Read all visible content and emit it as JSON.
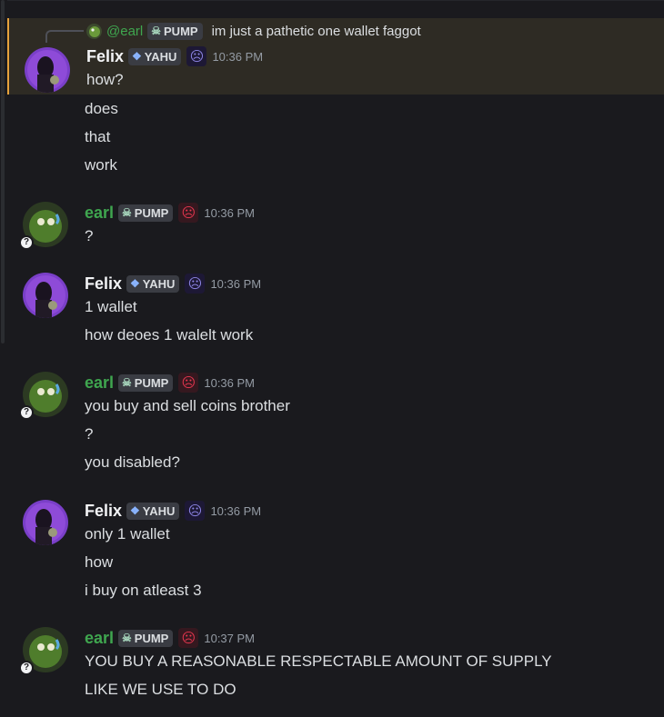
{
  "reply": {
    "mention": "@earl",
    "tag": "PUMP",
    "text": "im just a pathetic one wallet faggot"
  },
  "messages": [
    {
      "author": "Felix",
      "tag": "YAHU",
      "time": "10:36 PM",
      "lines": [
        "how?",
        "does",
        "that",
        "work"
      ]
    },
    {
      "author": "earl",
      "tag": "PUMP",
      "time": "10:36 PM",
      "lines": [
        "?"
      ]
    },
    {
      "author": "Felix",
      "tag": "YAHU",
      "time": "10:36 PM",
      "lines": [
        "1 wallet",
        "how deoes 1 walelt work"
      ]
    },
    {
      "author": "earl",
      "tag": "PUMP",
      "time": "10:36 PM",
      "lines": [
        "you buy and sell coins brother",
        "?",
        "you disabled?"
      ]
    },
    {
      "author": "Felix",
      "tag": "YAHU",
      "time": "10:36 PM",
      "lines": [
        "only 1 wallet",
        "how",
        "i buy on atleast 3"
      ]
    },
    {
      "author": "earl",
      "tag": "PUMP",
      "time": "10:37 PM",
      "lines": [
        "YOU BUY A REASONABLE RESPECTABLE AMOUNT OF SUPPLY",
        "LIKE WE USE TO DO"
      ]
    }
  ],
  "icons": {
    "status": "?",
    "mood": "frown-face-icon",
    "tag_pump": "skull-icon",
    "tag_yahu": "diamond-icon"
  },
  "colors": {
    "highlight_bar": "#e6a23c",
    "earl_name": "#3fa64f",
    "felix_name": "#f2f3f5",
    "background": "#1a1a1e"
  }
}
